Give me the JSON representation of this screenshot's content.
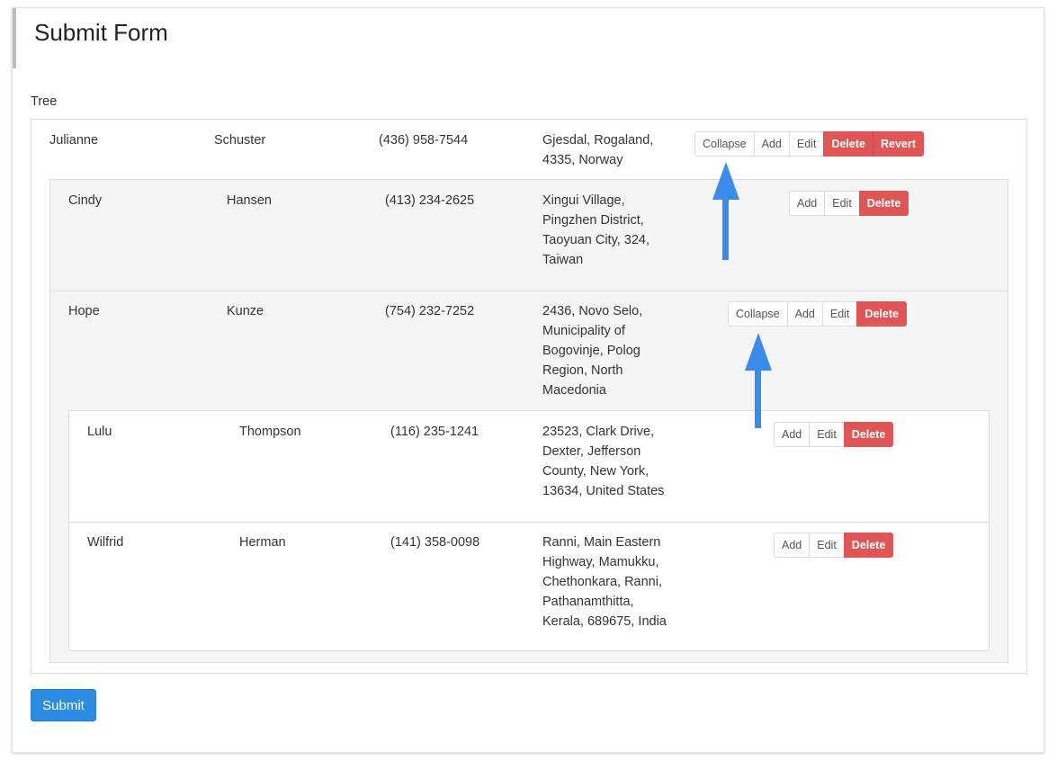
{
  "form": {
    "title": "Submit Form",
    "tree_label": "Tree",
    "submit_label": "Submit"
  },
  "buttons": {
    "collapse": "Collapse",
    "add": "Add",
    "edit": "Edit",
    "delete": "Delete",
    "revert": "Revert"
  },
  "nodes": {
    "julianne": {
      "first": "Julianne",
      "last": "Schuster",
      "phone": "(436) 958-7544",
      "address": "Gjesdal, Rogaland, 4335, Norway"
    },
    "cindy": {
      "first": "Cindy",
      "last": "Hansen",
      "phone": "(413) 234-2625",
      "address": "Xingui Village, Pingzhen District, Taoyuan City, 324, Taiwan"
    },
    "hope": {
      "first": "Hope",
      "last": "Kunze",
      "phone": "(754) 232-7252",
      "address": "2436, Novo Selo, Municipality of Bogovinje, Polog Region, North Macedonia"
    },
    "lulu": {
      "first": "Lulu",
      "last": "Thompson",
      "phone": "(116) 235-1241",
      "address": "23523, Clark Drive, Dexter, Jefferson County, New York, 13634, United States"
    },
    "wilfrid": {
      "first": "Wilfrid",
      "last": "Herman",
      "phone": "(141) 358-0098",
      "address": "Ranni, Main Eastern Highway, Mamukku, Chethonkara, Ranni, Pathanamthitta, Kerala, 689675, India"
    }
  },
  "colors": {
    "primary": "#2b8ce0",
    "danger": "#e05555",
    "arrow": "#3b8beb",
    "level2_bg": "#f5f5f5"
  }
}
